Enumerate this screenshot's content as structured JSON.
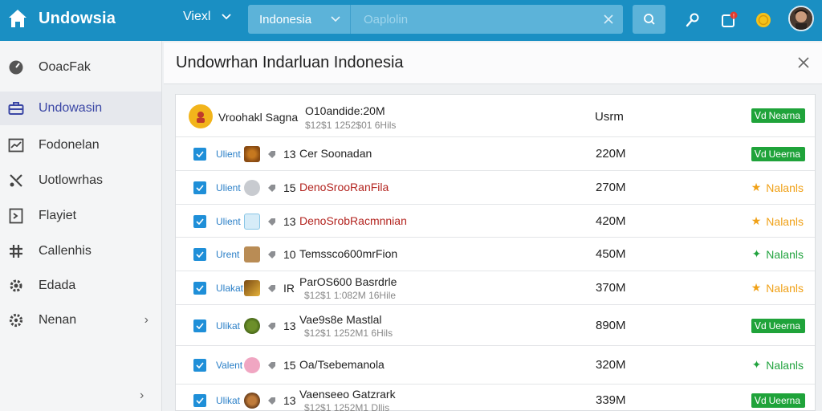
{
  "app": {
    "name": "Undowsia"
  },
  "topbar": {
    "view_label": "Viexl",
    "region_select": "Indonesia",
    "search_placeholder": "Oaplolin"
  },
  "sidebar": {
    "items": [
      {
        "label": "OoacFak",
        "icon": "speedometer-icon"
      },
      {
        "label": "Undowasin",
        "icon": "briefcase-icon",
        "active": true
      },
      {
        "label": "Fodonelan",
        "icon": "chart-icon"
      },
      {
        "label": "Uotlowrhas",
        "icon": "tools-icon"
      },
      {
        "label": "Flayiet",
        "icon": "exit-icon"
      },
      {
        "label": "Callenhis",
        "icon": "grid-icon"
      },
      {
        "label": "Edada",
        "icon": "gear-icon"
      },
      {
        "label": "Nenan",
        "icon": "settings-icon"
      }
    ]
  },
  "panel": {
    "title": "Undowrhan Indarluan Indonesia"
  },
  "table": {
    "header": {
      "name": "Vroohakl Sagna",
      "main": "O10andide:20M",
      "sub": "$12$1 1252$01 6Hils",
      "user_label": "Usrm",
      "badge": "Nearna"
    },
    "rows": [
      {
        "tag": "Ulient",
        "num": "13",
        "name": "Cer Soonadan",
        "sub": "",
        "size": "220M",
        "status": "Ueerna",
        "status_type": "badge",
        "name_color": "#222"
      },
      {
        "tag": "Ulient",
        "num": "15",
        "name": "DenoSrooRanFila",
        "sub": "",
        "size": "270M",
        "status": "Nalanls",
        "status_type": "star",
        "name_color": "#b3241f"
      },
      {
        "tag": "Ulient",
        "num": "13",
        "name": "DenoSrobRacmnnian",
        "sub": "",
        "size": "420M",
        "status": "Nalanls",
        "status_type": "star",
        "name_color": "#b3241f"
      },
      {
        "tag": "Urent",
        "num": "10",
        "name": "Temssco600mrFion",
        "sub": "",
        "size": "450M",
        "status": "Nalanls",
        "status_type": "leaf",
        "name_color": "#222"
      },
      {
        "tag": "Ulakat",
        "num": "IR",
        "name": "ParOS600 Basrdrle",
        "sub": "$12$1 1:082M 16Hile",
        "size": "370M",
        "status": "Nalanls",
        "status_type": "star",
        "name_color": "#222"
      },
      {
        "tag": "Ulikat",
        "num": "13",
        "name": "Vae9s8e Mastlal",
        "sub": "$12$1 1252M1 6Hils",
        "size": "890M",
        "status": "Ueerna",
        "status_type": "badge",
        "name_color": "#222"
      },
      {
        "tag": "Valent",
        "num": "15",
        "name": "Oa/Tsebemanola",
        "sub": "",
        "size": "320M",
        "status": "Nalanls",
        "status_type": "leaf",
        "name_color": "#222"
      },
      {
        "tag": "Ulikat",
        "num": "13",
        "name": "Vaenseeo Gatzrark",
        "sub": "$12$1 1252M1 Dllis",
        "size": "339M",
        "status": "Ueerna",
        "status_type": "badge",
        "name_color": "#222"
      }
    ]
  },
  "colors": {
    "topbar": "#1a8fc3",
    "accent": "#3a46a5",
    "badge_green": "#1fa33a",
    "star_orange": "#f0a117",
    "leaf_green": "#22a33f"
  }
}
